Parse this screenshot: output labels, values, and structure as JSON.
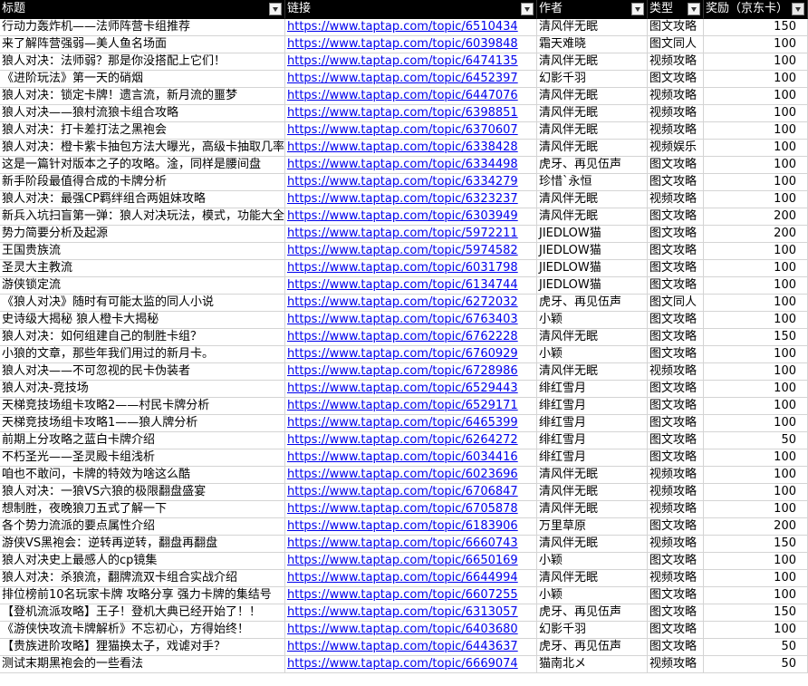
{
  "headers": [
    "标题",
    "链接",
    "作者",
    "类型",
    "奖励（京东卡）"
  ],
  "rows": [
    [
      "行动力轰炸机——法师阵营卡组推荐",
      "https://www.taptap.com/topic/6510434",
      "清风伴无眠",
      "图文攻略",
      "150"
    ],
    [
      "来了解阵营强弱—美人鱼名场面",
      "https://www.taptap.com/topic/6039848",
      "霜天难晓",
      "图文同人",
      "100"
    ],
    [
      "狼人对决：法师弱？那是你没搭配上它们！",
      "https://www.taptap.com/topic/6474135",
      "清风伴无眠",
      "视频攻略",
      "100"
    ],
    [
      "《进阶玩法》第一天的硝烟",
      "https://www.taptap.com/topic/6452397",
      "幻影千羽",
      "图文攻略",
      "100"
    ],
    [
      "狼人对决：锁定卡牌！遗言流，新月流的噩梦",
      "https://www.taptap.com/topic/6447076",
      "清风伴无眠",
      "视频攻略",
      "100"
    ],
    [
      "狼人对决——狼村流狼卡组合攻略",
      "https://www.taptap.com/topic/6398851",
      "清风伴无眠",
      "视频攻略",
      "100"
    ],
    [
      "狼人对决：打卡差打法之黑袍会",
      "https://www.taptap.com/topic/6370607",
      "清风伴无眠",
      "视频攻略",
      "100"
    ],
    [
      "狼人对决：橙卡紫卡抽包方法大曝光，高级卡抽取几率",
      "https://www.taptap.com/topic/6338428",
      "清风伴无眠",
      "视频娱乐",
      "100"
    ],
    [
      "这是一篇针对版本之子的攻略。淦，同样是腰间盘",
      "https://www.taptap.com/topic/6334498",
      "虎牙、再见伍声",
      "图文攻略",
      "100"
    ],
    [
      "新手阶段最值得合成的卡牌分析",
      "https://www.taptap.com/topic/6334279",
      "珍惜`永恒",
      "图文攻略",
      "100"
    ],
    [
      "狼人对决：最强CP羁绊组合两姐妹攻略",
      "https://www.taptap.com/topic/6323237",
      "清风伴无眠",
      "视频攻略",
      "100"
    ],
    [
      "新兵入坑扫盲第一弹：狼人对决玩法，模式，功能大全",
      "https://www.taptap.com/topic/6303949",
      "清风伴无眠",
      "图文攻略",
      "200"
    ],
    [
      "势力简要分析及起源",
      "https://www.taptap.com/topic/5972211",
      "JIEDLOW猫",
      "图文攻略",
      "200"
    ],
    [
      "王国贵族流",
      "https://www.taptap.com/topic/5974582",
      "JIEDLOW猫",
      "图文攻略",
      "100"
    ],
    [
      "圣灵大主教流",
      "https://www.taptap.com/topic/6031798",
      "JIEDLOW猫",
      "图文攻略",
      "100"
    ],
    [
      "游侠锁定流",
      "https://www.taptap.com/topic/6134744",
      "JIEDLOW猫",
      "图文攻略",
      "100"
    ],
    [
      "《狼人对决》随时有可能太监的同人小说",
      "https://www.taptap.com/topic/6272032",
      "虎牙、再见伍声",
      "图文同人",
      "100"
    ],
    [
      "史诗级大揭秘 狼人橙卡大揭秘",
      "https://www.taptap.com/topic/6763403",
      "小颖",
      "图文攻略",
      "100"
    ],
    [
      "狼人对决：如何组建自己的制胜卡组？",
      "https://www.taptap.com/topic/6762228",
      "清风伴无眠",
      "图文攻略",
      "150"
    ],
    [
      "小狼的文章，那些年我们用过的新月卡。",
      "https://www.taptap.com/topic/6760929",
      "小颖",
      "图文攻略",
      "100"
    ],
    [
      "狼人对决——不可忽视的民卡伪装者",
      "https://www.taptap.com/topic/6728986",
      "清风伴无眠",
      "视频攻略",
      "100"
    ],
    [
      "狼人对决-竞技场",
      "https://www.taptap.com/topic/6529443",
      "绯红雪月",
      "图文攻略",
      "100"
    ],
    [
      "天梯竞技场组卡攻略2——村民卡牌分析",
      "https://www.taptap.com/topic/6529171",
      "绯红雪月",
      "图文攻略",
      "100"
    ],
    [
      "天梯竞技场组卡攻略1——狼人牌分析",
      "https://www.taptap.com/topic/6465399",
      "绯红雪月",
      "图文攻略",
      "100"
    ],
    [
      "前期上分攻略之蓝白卡牌介绍",
      "https://www.taptap.com/topic/6264272",
      "绯红雪月",
      "图文攻略",
      "50"
    ],
    [
      "不朽圣光——圣灵殿卡组浅析",
      "https://www.taptap.com/topic/6034416",
      "绯红雪月",
      "图文攻略",
      "100"
    ],
    [
      "咱也不敢问，卡牌的特效为啥这么酷",
      "https://www.taptap.com/topic/6023696",
      "清风伴无眠",
      "视频攻略",
      "100"
    ],
    [
      "狼人对决：一狼VS六狼的极限翻盘盛宴",
      "https://www.taptap.com/topic/6706847",
      "清风伴无眠",
      "视频攻略",
      "100"
    ],
    [
      "想制胜，夜晚狼刀五式了解一下",
      "https://www.taptap.com/topic/6705878",
      "清风伴无眠",
      "视频攻略",
      "100"
    ],
    [
      "各个势力流派的要点属性介绍",
      "https://www.taptap.com/topic/6183906",
      "万里草原",
      "图文攻略",
      "200"
    ],
    [
      "游侠VS黑袍会：逆转再逆转，翻盘再翻盘",
      "https://www.taptap.com/topic/6660743",
      "清风伴无眠",
      "视频攻略",
      "150"
    ],
    [
      "狼人对决史上最感人的cp镜集",
      "https://www.taptap.com/topic/6650169",
      "小颖",
      "图文攻略",
      "100"
    ],
    [
      "狼人对决：杀狼流，翻牌流双卡组合实战介绍",
      "https://www.taptap.com/topic/6644994",
      "清风伴无眠",
      "视频攻略",
      "100"
    ],
    [
      "排位榜前10名玩家卡牌 攻略分享 强力卡牌的集结号",
      "https://www.taptap.com/topic/6607255",
      "小颖",
      "图文攻略",
      "100"
    ],
    [
      "【登机流派攻略】王子！登机大典已经开始了！！",
      "https://www.taptap.com/topic/6313057",
      "虎牙、再见伍声",
      "图文攻略",
      "150"
    ],
    [
      "《游侠快攻流卡牌解析》不忘初心，方得始终！",
      "https://www.taptap.com/topic/6403680",
      "幻影千羽",
      "图文攻略",
      "100"
    ],
    [
      "【贵族进阶攻略】狸猫换太子，戏谑对手？",
      "https://www.taptap.com/topic/6443637",
      "虎牙、再见伍声",
      "图文攻略",
      "50"
    ],
    [
      "测试末期黑袍会的一些看法",
      "https://www.taptap.com/topic/6669074",
      "猫南北メ",
      "视频攻略",
      "50"
    ]
  ],
  "filter_icon": "dropdown-filter-icon",
  "colors": {
    "header_bg": "#000000",
    "header_text": "#ffffff",
    "link": "#0000ee",
    "grid": "#d4d4d4"
  }
}
